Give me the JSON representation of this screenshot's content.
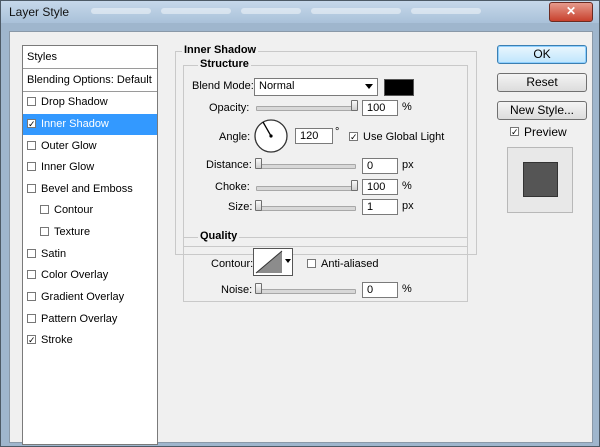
{
  "window": {
    "title": "Layer Style",
    "close_glyph": "✕"
  },
  "sidebar": {
    "styles_header": "Styles",
    "blending_header": "Blending Options: Default",
    "items": [
      {
        "label": "Drop Shadow",
        "checked": false
      },
      {
        "label": "Inner Shadow",
        "checked": true,
        "selected": true
      },
      {
        "label": "Outer Glow",
        "checked": false
      },
      {
        "label": "Inner Glow",
        "checked": false
      },
      {
        "label": "Bevel and Emboss",
        "checked": false
      },
      {
        "label": "Contour",
        "checked": false,
        "sub": true
      },
      {
        "label": "Texture",
        "checked": false,
        "sub": true
      },
      {
        "label": "Satin",
        "checked": false
      },
      {
        "label": "Color Overlay",
        "checked": false
      },
      {
        "label": "Gradient Overlay",
        "checked": false
      },
      {
        "label": "Pattern Overlay",
        "checked": false
      },
      {
        "label": "Stroke",
        "checked": true
      }
    ]
  },
  "inner_shadow": {
    "title": "Inner Shadow",
    "structure": {
      "title": "Structure",
      "blend_mode": {
        "label": "Blend Mode:",
        "value": "Normal",
        "color": "#000000"
      },
      "opacity": {
        "label": "Opacity:",
        "value": "100",
        "unit": "%",
        "level": 1.0
      },
      "angle": {
        "label": "Angle:",
        "value": "120",
        "unit": "°",
        "use_global_light_label": "Use Global Light",
        "use_global_light": true
      },
      "distance": {
        "label": "Distance:",
        "value": "0",
        "unit": "px",
        "level": 0.0
      },
      "choke": {
        "label": "Choke:",
        "value": "100",
        "unit": "%",
        "level": 1.0
      },
      "size": {
        "label": "Size:",
        "value": "1",
        "unit": "px",
        "level": 0.0
      }
    },
    "quality": {
      "title": "Quality",
      "contour_label": "Contour:",
      "anti_aliased_label": "Anti-aliased",
      "anti_aliased": false,
      "noise": {
        "label": "Noise:",
        "value": "0",
        "unit": "%",
        "level": 0.0
      }
    }
  },
  "buttons": {
    "ok": "OK",
    "reset": "Reset",
    "new_style": "New Style..."
  },
  "preview": {
    "label": "Preview",
    "checked": true,
    "swatch_color": "#555555"
  },
  "check_glyph": "✓"
}
